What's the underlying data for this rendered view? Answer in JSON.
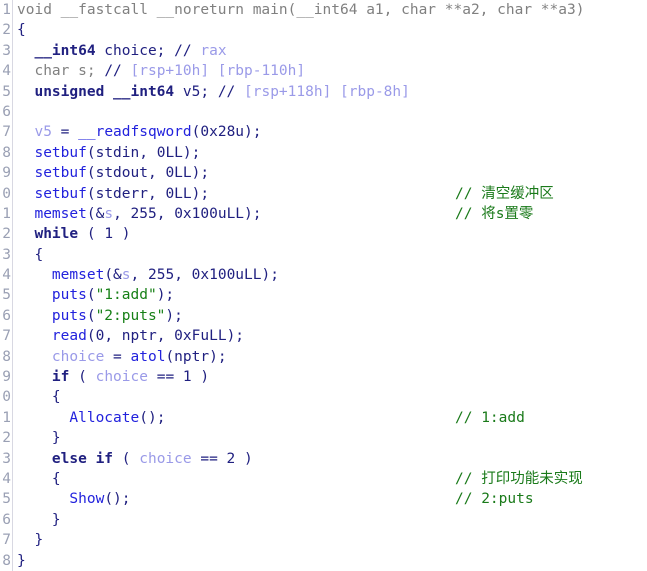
{
  "view": {
    "title": "IDA Pseudocode View",
    "background": "#ffffff",
    "gutter_color": "#9aa0b4",
    "colors": {
      "keyword": "#202080",
      "plain": "#202080",
      "dimmed": "#808080",
      "library_function": "#2222dd",
      "user_function": "#2222dd",
      "string_literal": "#178017",
      "number": "#202080",
      "local_variable": "#9a9ae8",
      "register": "#9a9ae8",
      "chinese_comment": "#1a7a1a"
    }
  },
  "lines": [
    {
      "number": "1",
      "code": "void __fastcall __noreturn main(__int64 a1, char **a2, char **a3)",
      "comment": ""
    },
    {
      "number": "2",
      "code": "{",
      "comment": ""
    },
    {
      "number": "3",
      "code": "  __int64 choice; // rax",
      "comment": ""
    },
    {
      "number": "4",
      "code": "  char s; // [rsp+10h] [rbp-110h]",
      "comment": ""
    },
    {
      "number": "5",
      "code": "  unsigned __int64 v5; // [rsp+118h] [rbp-8h]",
      "comment": ""
    },
    {
      "number": "6",
      "code": "",
      "comment": ""
    },
    {
      "number": "7",
      "code": "  v5 = __readfsqword(0x28u);",
      "comment": ""
    },
    {
      "number": "8",
      "code": "  setbuf(stdin, 0LL);",
      "comment": ""
    },
    {
      "number": "9",
      "code": "  setbuf(stdout, 0LL);",
      "comment": ""
    },
    {
      "number": "0",
      "code": "  setbuf(stderr, 0LL);",
      "comment": "// 清空缓冲区"
    },
    {
      "number": "1",
      "code": "  memset(&s, 255, 0x100uLL);",
      "comment": "// 将s置零"
    },
    {
      "number": "2",
      "code": "  while ( 1 )",
      "comment": ""
    },
    {
      "number": "3",
      "code": "  {",
      "comment": ""
    },
    {
      "number": "4",
      "code": "    memset(&s, 255, 0x100uLL);",
      "comment": ""
    },
    {
      "number": "5",
      "code": "    puts(\"1:add\");",
      "comment": ""
    },
    {
      "number": "6",
      "code": "    puts(\"2:puts\");",
      "comment": ""
    },
    {
      "number": "7",
      "code": "    read(0, nptr, 0xFuLL);",
      "comment": ""
    },
    {
      "number": "8",
      "code": "    choice = atol(nptr);",
      "comment": ""
    },
    {
      "number": "9",
      "code": "    if ( choice == 1 )",
      "comment": ""
    },
    {
      "number": "0",
      "code": "    {",
      "comment": ""
    },
    {
      "number": "1",
      "code": "      Allocate();",
      "comment": "// 1:add"
    },
    {
      "number": "2",
      "code": "    }",
      "comment": ""
    },
    {
      "number": "3",
      "code": "    else if ( choice == 2 )",
      "comment": ""
    },
    {
      "number": "4",
      "code": "    {",
      "comment": "// 打印功能未实现"
    },
    {
      "number": "5",
      "code": "      Show();",
      "comment": "// 2:puts"
    },
    {
      "number": "6",
      "code": "    }",
      "comment": ""
    },
    {
      "number": "7",
      "code": "  }",
      "comment": ""
    },
    {
      "number": "8",
      "code": "}",
      "comment": ""
    }
  ],
  "tokens": [
    [
      {
        "t": "void __fastcall __noreturn main(__int64 a1, char **a2, char **a3)",
        "c": "tok-dim"
      }
    ],
    [
      {
        "t": "{",
        "c": "tok-plain"
      }
    ],
    [
      {
        "t": "  ",
        "c": "tok-plain"
      },
      {
        "t": "__int64",
        "c": "tok-keyword"
      },
      {
        "t": " choice; ",
        "c": "tok-plain"
      },
      {
        "t": "//",
        "c": "tok-comment"
      },
      {
        "t": " rax",
        "c": "tok-reg"
      }
    ],
    [
      {
        "t": "  char s; ",
        "c": "tok-dim"
      },
      {
        "t": "//",
        "c": "tok-comment"
      },
      {
        "t": " [rsp+10h] [rbp-110h]",
        "c": "tok-reg"
      }
    ],
    [
      {
        "t": "  ",
        "c": "tok-plain"
      },
      {
        "t": "unsigned __int64",
        "c": "tok-keyword"
      },
      {
        "t": " v5; ",
        "c": "tok-plain"
      },
      {
        "t": "//",
        "c": "tok-comment"
      },
      {
        "t": " [rsp+118h] [rbp-8h]",
        "c": "tok-reg"
      }
    ],
    [
      {
        "t": "",
        "c": "tok-plain"
      }
    ],
    [
      {
        "t": "  ",
        "c": "tok-plain"
      },
      {
        "t": "v5",
        "c": "tok-localvar"
      },
      {
        "t": " = ",
        "c": "tok-plain"
      },
      {
        "t": "__readfsqword",
        "c": "tok-libfunc"
      },
      {
        "t": "(",
        "c": "tok-plain"
      },
      {
        "t": "0x28u",
        "c": "tok-number"
      },
      {
        "t": ");",
        "c": "tok-plain"
      }
    ],
    [
      {
        "t": "  ",
        "c": "tok-plain"
      },
      {
        "t": "setbuf",
        "c": "tok-libfunc"
      },
      {
        "t": "(",
        "c": "tok-plain"
      },
      {
        "t": "stdin",
        "c": "tok-plain"
      },
      {
        "t": ", ",
        "c": "tok-plain"
      },
      {
        "t": "0LL",
        "c": "tok-number"
      },
      {
        "t": ");",
        "c": "tok-plain"
      }
    ],
    [
      {
        "t": "  ",
        "c": "tok-plain"
      },
      {
        "t": "setbuf",
        "c": "tok-libfunc"
      },
      {
        "t": "(",
        "c": "tok-plain"
      },
      {
        "t": "stdout",
        "c": "tok-plain"
      },
      {
        "t": ", ",
        "c": "tok-plain"
      },
      {
        "t": "0LL",
        "c": "tok-number"
      },
      {
        "t": ");",
        "c": "tok-plain"
      }
    ],
    [
      {
        "t": "  ",
        "c": "tok-plain"
      },
      {
        "t": "setbuf",
        "c": "tok-libfunc"
      },
      {
        "t": "(",
        "c": "tok-plain"
      },
      {
        "t": "stderr",
        "c": "tok-plain"
      },
      {
        "t": ", ",
        "c": "tok-plain"
      },
      {
        "t": "0LL",
        "c": "tok-number"
      },
      {
        "t": ");",
        "c": "tok-plain"
      }
    ],
    [
      {
        "t": "  ",
        "c": "tok-plain"
      },
      {
        "t": "memset",
        "c": "tok-libfunc"
      },
      {
        "t": "(&",
        "c": "tok-plain"
      },
      {
        "t": "s",
        "c": "tok-localvar"
      },
      {
        "t": ", ",
        "c": "tok-plain"
      },
      {
        "t": "255",
        "c": "tok-number"
      },
      {
        "t": ", ",
        "c": "tok-plain"
      },
      {
        "t": "0x100uLL",
        "c": "tok-number"
      },
      {
        "t": ");",
        "c": "tok-plain"
      }
    ],
    [
      {
        "t": "  ",
        "c": "tok-plain"
      },
      {
        "t": "while",
        "c": "tok-keyword"
      },
      {
        "t": " ( ",
        "c": "tok-plain"
      },
      {
        "t": "1",
        "c": "tok-number"
      },
      {
        "t": " )",
        "c": "tok-plain"
      }
    ],
    [
      {
        "t": "  {",
        "c": "tok-plain"
      }
    ],
    [
      {
        "t": "    ",
        "c": "tok-plain"
      },
      {
        "t": "memset",
        "c": "tok-libfunc"
      },
      {
        "t": "(&",
        "c": "tok-plain"
      },
      {
        "t": "s",
        "c": "tok-localvar"
      },
      {
        "t": ", ",
        "c": "tok-plain"
      },
      {
        "t": "255",
        "c": "tok-number"
      },
      {
        "t": ", ",
        "c": "tok-plain"
      },
      {
        "t": "0x100uLL",
        "c": "tok-number"
      },
      {
        "t": ");",
        "c": "tok-plain"
      }
    ],
    [
      {
        "t": "    ",
        "c": "tok-plain"
      },
      {
        "t": "puts",
        "c": "tok-libfunc"
      },
      {
        "t": "(",
        "c": "tok-plain"
      },
      {
        "t": "\"1:add\"",
        "c": "tok-string"
      },
      {
        "t": ");",
        "c": "tok-plain"
      }
    ],
    [
      {
        "t": "    ",
        "c": "tok-plain"
      },
      {
        "t": "puts",
        "c": "tok-libfunc"
      },
      {
        "t": "(",
        "c": "tok-plain"
      },
      {
        "t": "\"2:puts\"",
        "c": "tok-string"
      },
      {
        "t": ");",
        "c": "tok-plain"
      }
    ],
    [
      {
        "t": "    ",
        "c": "tok-plain"
      },
      {
        "t": "read",
        "c": "tok-libfunc"
      },
      {
        "t": "(",
        "c": "tok-plain"
      },
      {
        "t": "0",
        "c": "tok-number"
      },
      {
        "t": ", ",
        "c": "tok-plain"
      },
      {
        "t": "nptr",
        "c": "tok-plain"
      },
      {
        "t": ", ",
        "c": "tok-plain"
      },
      {
        "t": "0xFuLL",
        "c": "tok-number"
      },
      {
        "t": ");",
        "c": "tok-plain"
      }
    ],
    [
      {
        "t": "    ",
        "c": "tok-plain"
      },
      {
        "t": "choice",
        "c": "tok-localvar"
      },
      {
        "t": " = ",
        "c": "tok-plain"
      },
      {
        "t": "atol",
        "c": "tok-libfunc"
      },
      {
        "t": "(",
        "c": "tok-plain"
      },
      {
        "t": "nptr",
        "c": "tok-plain"
      },
      {
        "t": ");",
        "c": "tok-plain"
      }
    ],
    [
      {
        "t": "    ",
        "c": "tok-plain"
      },
      {
        "t": "if",
        "c": "tok-keyword"
      },
      {
        "t": " ( ",
        "c": "tok-plain"
      },
      {
        "t": "choice",
        "c": "tok-localvar"
      },
      {
        "t": " == ",
        "c": "tok-plain"
      },
      {
        "t": "1",
        "c": "tok-number"
      },
      {
        "t": " )",
        "c": "tok-plain"
      }
    ],
    [
      {
        "t": "    {",
        "c": "tok-plain"
      }
    ],
    [
      {
        "t": "      ",
        "c": "tok-plain"
      },
      {
        "t": "Allocate",
        "c": "tok-userfunc"
      },
      {
        "t": "();",
        "c": "tok-plain"
      }
    ],
    [
      {
        "t": "    }",
        "c": "tok-plain"
      }
    ],
    [
      {
        "t": "    ",
        "c": "tok-plain"
      },
      {
        "t": "else if",
        "c": "tok-keyword"
      },
      {
        "t": " ( ",
        "c": "tok-plain"
      },
      {
        "t": "choice",
        "c": "tok-localvar"
      },
      {
        "t": " == ",
        "c": "tok-plain"
      },
      {
        "t": "2",
        "c": "tok-number"
      },
      {
        "t": " )",
        "c": "tok-plain"
      }
    ],
    [
      {
        "t": "    {",
        "c": "tok-plain"
      }
    ],
    [
      {
        "t": "      ",
        "c": "tok-plain"
      },
      {
        "t": "Show",
        "c": "tok-userfunc"
      },
      {
        "t": "();",
        "c": "tok-plain"
      }
    ],
    [
      {
        "t": "    }",
        "c": "tok-plain"
      }
    ],
    [
      {
        "t": "  }",
        "c": "tok-plain"
      }
    ],
    [
      {
        "t": "}",
        "c": "tok-plain"
      }
    ]
  ]
}
